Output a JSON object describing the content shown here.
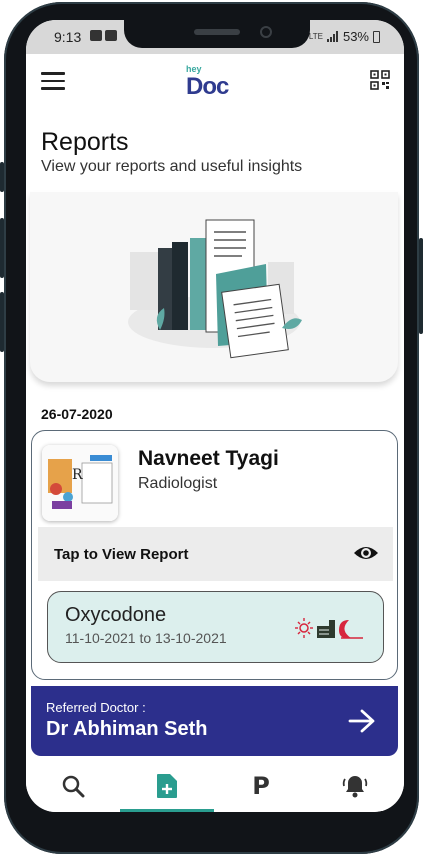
{
  "status_bar": {
    "time": "9:13",
    "network": "LTE",
    "battery": "53%"
  },
  "header": {
    "logo_top": "hey",
    "logo_main": "Doc"
  },
  "page": {
    "title": "Reports",
    "subtitle": "View your reports and useful insights"
  },
  "report": {
    "date": "26-07-2020",
    "doctor_name": "Navneet Tyagi",
    "doctor_specialty": "Radiologist",
    "tap_label": "Tap to View Report",
    "medicine": {
      "name": "Oxycodone",
      "dates": "11-10-2021 to 13-10-2021"
    }
  },
  "referred": {
    "label": "Referred Doctor :",
    "name": "Dr Abhiman Seth"
  },
  "bottom_nav": {
    "items": [
      {
        "name": "search",
        "icon": "search-icon"
      },
      {
        "name": "reports",
        "icon": "add-document-icon",
        "active": true
      },
      {
        "name": "pharmacy",
        "icon": "p-icon",
        "label": "P"
      },
      {
        "name": "reminders",
        "icon": "bell-icon"
      }
    ]
  },
  "colors": {
    "brand": "#2f3b8f",
    "accent": "#2a9d8f",
    "banner": "#2c2f8c",
    "medicine_bg": "#dcefed"
  }
}
